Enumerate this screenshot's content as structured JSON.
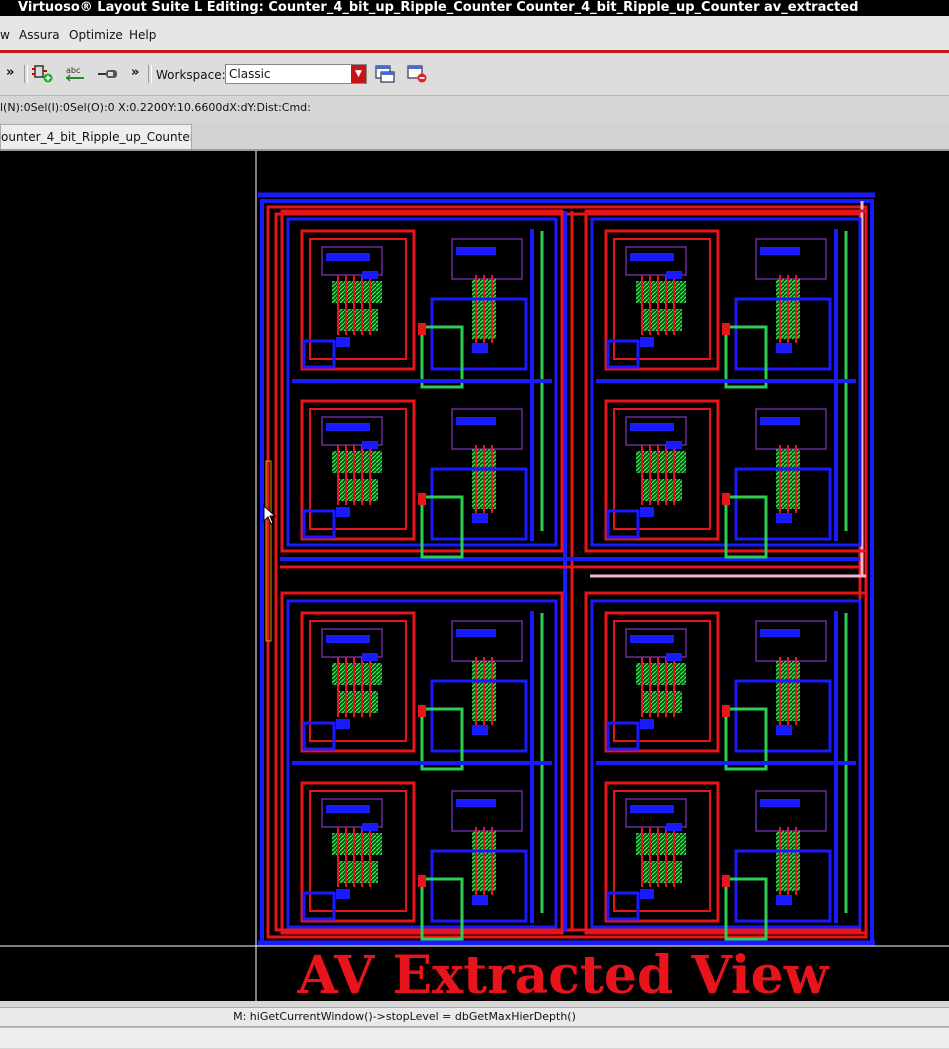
{
  "window": {
    "title": "Virtuoso® Layout Suite L Editing: Counter_4_bit_up_Ripple_Counter Counter_4_bit_Ripple_up_Counter av_extracted"
  },
  "menu": {
    "items": [
      "w",
      "Assura",
      "Optimize",
      "Help"
    ]
  },
  "toolbar": {
    "more1": "»",
    "more2": "»",
    "workspace_label": "Workspace:",
    "workspace_value": "Classic"
  },
  "status": {
    "text": "l(N):0Sel(I):0Sel(O):0  X:0.2200Y:10.6600dX:dY:Dist:Cmd:"
  },
  "tabs": [
    {
      "label": "ounter_4_bit_Ripple_up_Counter"
    }
  ],
  "canvas": {
    "overlay_text": "AV Extracted View"
  },
  "command": {
    "text": "M: hiGetCurrentWindow()->stopLevel = dbGetMaxHierDepth()"
  },
  "colors": {
    "metal1": "#1a1aff",
    "poly": "#e8141c",
    "metal2": "#2ecc55",
    "boundary": "#ffffff",
    "overlay_text": "#e8141c"
  }
}
